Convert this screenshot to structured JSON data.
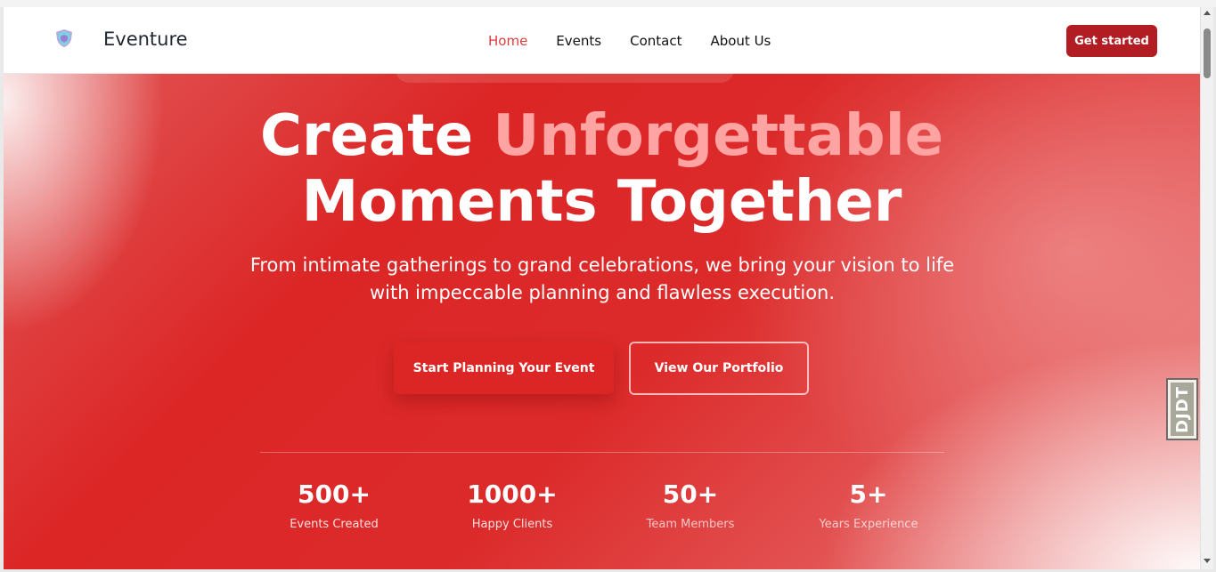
{
  "navbar": {
    "brand": "Eventure",
    "logo_icon": "shield-logo-icon",
    "links": [
      {
        "label": "Home",
        "active": true
      },
      {
        "label": "Events",
        "active": false
      },
      {
        "label": "Contact",
        "active": false
      },
      {
        "label": "About Us",
        "active": false
      }
    ],
    "cta_label": "Get started"
  },
  "hero": {
    "title_part1": "Create",
    "title_accent": "Unforgettable",
    "title_line2": "Moments Together",
    "subtitle": "From intimate gatherings to grand celebrations, we bring your vision to life with impeccable planning and flawless execution.",
    "primary_button": "Start Planning Your Event",
    "secondary_button": "View Our Portfolio"
  },
  "stats": [
    {
      "value": "500+",
      "label": "Events Created"
    },
    {
      "value": "1000+",
      "label": "Happy Clients"
    },
    {
      "value": "50+",
      "label": "Team Members"
    },
    {
      "value": "5+",
      "label": "Years Experience"
    }
  ],
  "side_widget": {
    "label": "DJDT"
  },
  "colors": {
    "brand_red": "#dc2626",
    "cta_red": "#b21c23",
    "nav_active": "#dc3c3c",
    "accent_pink": "#ffa3a3"
  }
}
